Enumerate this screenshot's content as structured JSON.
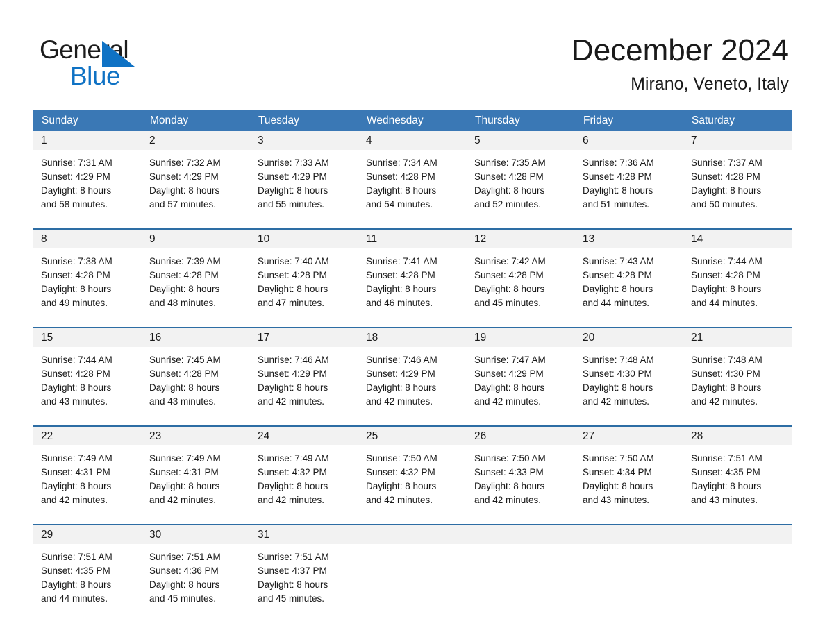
{
  "brand": {
    "name_part1": "General",
    "name_part2": "Blue",
    "logo_icon": "triangle-logo-icon",
    "accent_color": "#0f72c4"
  },
  "header": {
    "month_title": "December 2024",
    "location": "Mirano, Veneto, Italy"
  },
  "theme": {
    "header_blue": "#3a78b5",
    "row_divider_blue": "#2d6da4",
    "daynum_band": "#f2f2f2"
  },
  "calendar": {
    "weekday_headers": [
      "Sunday",
      "Monday",
      "Tuesday",
      "Wednesday",
      "Thursday",
      "Friday",
      "Saturday"
    ],
    "weeks": [
      [
        {
          "day": "1",
          "sunrise": "Sunrise: 7:31 AM",
          "sunset": "Sunset: 4:29 PM",
          "daylight1": "Daylight: 8 hours",
          "daylight2": "and 58 minutes."
        },
        {
          "day": "2",
          "sunrise": "Sunrise: 7:32 AM",
          "sunset": "Sunset: 4:29 PM",
          "daylight1": "Daylight: 8 hours",
          "daylight2": "and 57 minutes."
        },
        {
          "day": "3",
          "sunrise": "Sunrise: 7:33 AM",
          "sunset": "Sunset: 4:29 PM",
          "daylight1": "Daylight: 8 hours",
          "daylight2": "and 55 minutes."
        },
        {
          "day": "4",
          "sunrise": "Sunrise: 7:34 AM",
          "sunset": "Sunset: 4:28 PM",
          "daylight1": "Daylight: 8 hours",
          "daylight2": "and 54 minutes."
        },
        {
          "day": "5",
          "sunrise": "Sunrise: 7:35 AM",
          "sunset": "Sunset: 4:28 PM",
          "daylight1": "Daylight: 8 hours",
          "daylight2": "and 52 minutes."
        },
        {
          "day": "6",
          "sunrise": "Sunrise: 7:36 AM",
          "sunset": "Sunset: 4:28 PM",
          "daylight1": "Daylight: 8 hours",
          "daylight2": "and 51 minutes."
        },
        {
          "day": "7",
          "sunrise": "Sunrise: 7:37 AM",
          "sunset": "Sunset: 4:28 PM",
          "daylight1": "Daylight: 8 hours",
          "daylight2": "and 50 minutes."
        }
      ],
      [
        {
          "day": "8",
          "sunrise": "Sunrise: 7:38 AM",
          "sunset": "Sunset: 4:28 PM",
          "daylight1": "Daylight: 8 hours",
          "daylight2": "and 49 minutes."
        },
        {
          "day": "9",
          "sunrise": "Sunrise: 7:39 AM",
          "sunset": "Sunset: 4:28 PM",
          "daylight1": "Daylight: 8 hours",
          "daylight2": "and 48 minutes."
        },
        {
          "day": "10",
          "sunrise": "Sunrise: 7:40 AM",
          "sunset": "Sunset: 4:28 PM",
          "daylight1": "Daylight: 8 hours",
          "daylight2": "and 47 minutes."
        },
        {
          "day": "11",
          "sunrise": "Sunrise: 7:41 AM",
          "sunset": "Sunset: 4:28 PM",
          "daylight1": "Daylight: 8 hours",
          "daylight2": "and 46 minutes."
        },
        {
          "day": "12",
          "sunrise": "Sunrise: 7:42 AM",
          "sunset": "Sunset: 4:28 PM",
          "daylight1": "Daylight: 8 hours",
          "daylight2": "and 45 minutes."
        },
        {
          "day": "13",
          "sunrise": "Sunrise: 7:43 AM",
          "sunset": "Sunset: 4:28 PM",
          "daylight1": "Daylight: 8 hours",
          "daylight2": "and 44 minutes."
        },
        {
          "day": "14",
          "sunrise": "Sunrise: 7:44 AM",
          "sunset": "Sunset: 4:28 PM",
          "daylight1": "Daylight: 8 hours",
          "daylight2": "and 44 minutes."
        }
      ],
      [
        {
          "day": "15",
          "sunrise": "Sunrise: 7:44 AM",
          "sunset": "Sunset: 4:28 PM",
          "daylight1": "Daylight: 8 hours",
          "daylight2": "and 43 minutes."
        },
        {
          "day": "16",
          "sunrise": "Sunrise: 7:45 AM",
          "sunset": "Sunset: 4:28 PM",
          "daylight1": "Daylight: 8 hours",
          "daylight2": "and 43 minutes."
        },
        {
          "day": "17",
          "sunrise": "Sunrise: 7:46 AM",
          "sunset": "Sunset: 4:29 PM",
          "daylight1": "Daylight: 8 hours",
          "daylight2": "and 42 minutes."
        },
        {
          "day": "18",
          "sunrise": "Sunrise: 7:46 AM",
          "sunset": "Sunset: 4:29 PM",
          "daylight1": "Daylight: 8 hours",
          "daylight2": "and 42 minutes."
        },
        {
          "day": "19",
          "sunrise": "Sunrise: 7:47 AM",
          "sunset": "Sunset: 4:29 PM",
          "daylight1": "Daylight: 8 hours",
          "daylight2": "and 42 minutes."
        },
        {
          "day": "20",
          "sunrise": "Sunrise: 7:48 AM",
          "sunset": "Sunset: 4:30 PM",
          "daylight1": "Daylight: 8 hours",
          "daylight2": "and 42 minutes."
        },
        {
          "day": "21",
          "sunrise": "Sunrise: 7:48 AM",
          "sunset": "Sunset: 4:30 PM",
          "daylight1": "Daylight: 8 hours",
          "daylight2": "and 42 minutes."
        }
      ],
      [
        {
          "day": "22",
          "sunrise": "Sunrise: 7:49 AM",
          "sunset": "Sunset: 4:31 PM",
          "daylight1": "Daylight: 8 hours",
          "daylight2": "and 42 minutes."
        },
        {
          "day": "23",
          "sunrise": "Sunrise: 7:49 AM",
          "sunset": "Sunset: 4:31 PM",
          "daylight1": "Daylight: 8 hours",
          "daylight2": "and 42 minutes."
        },
        {
          "day": "24",
          "sunrise": "Sunrise: 7:49 AM",
          "sunset": "Sunset: 4:32 PM",
          "daylight1": "Daylight: 8 hours",
          "daylight2": "and 42 minutes."
        },
        {
          "day": "25",
          "sunrise": "Sunrise: 7:50 AM",
          "sunset": "Sunset: 4:32 PM",
          "daylight1": "Daylight: 8 hours",
          "daylight2": "and 42 minutes."
        },
        {
          "day": "26",
          "sunrise": "Sunrise: 7:50 AM",
          "sunset": "Sunset: 4:33 PM",
          "daylight1": "Daylight: 8 hours",
          "daylight2": "and 42 minutes."
        },
        {
          "day": "27",
          "sunrise": "Sunrise: 7:50 AM",
          "sunset": "Sunset: 4:34 PM",
          "daylight1": "Daylight: 8 hours",
          "daylight2": "and 43 minutes."
        },
        {
          "day": "28",
          "sunrise": "Sunrise: 7:51 AM",
          "sunset": "Sunset: 4:35 PM",
          "daylight1": "Daylight: 8 hours",
          "daylight2": "and 43 minutes."
        }
      ],
      [
        {
          "day": "29",
          "sunrise": "Sunrise: 7:51 AM",
          "sunset": "Sunset: 4:35 PM",
          "daylight1": "Daylight: 8 hours",
          "daylight2": "and 44 minutes."
        },
        {
          "day": "30",
          "sunrise": "Sunrise: 7:51 AM",
          "sunset": "Sunset: 4:36 PM",
          "daylight1": "Daylight: 8 hours",
          "daylight2": "and 45 minutes."
        },
        {
          "day": "31",
          "sunrise": "Sunrise: 7:51 AM",
          "sunset": "Sunset: 4:37 PM",
          "daylight1": "Daylight: 8 hours",
          "daylight2": "and 45 minutes."
        },
        {
          "day": "",
          "sunrise": "",
          "sunset": "",
          "daylight1": "",
          "daylight2": ""
        },
        {
          "day": "",
          "sunrise": "",
          "sunset": "",
          "daylight1": "",
          "daylight2": ""
        },
        {
          "day": "",
          "sunrise": "",
          "sunset": "",
          "daylight1": "",
          "daylight2": ""
        },
        {
          "day": "",
          "sunrise": "",
          "sunset": "",
          "daylight1": "",
          "daylight2": ""
        }
      ]
    ]
  }
}
